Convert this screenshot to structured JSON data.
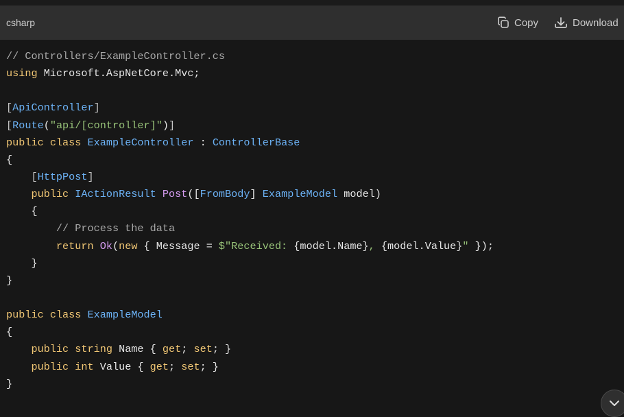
{
  "header": {
    "language": "csharp",
    "copy_label": "Copy",
    "download_label": "Download"
  },
  "code": {
    "lines": [
      [
        {
          "t": "cmt",
          "v": "// Controllers/ExampleController.cs"
        }
      ],
      [
        {
          "t": "kw",
          "v": "using"
        },
        {
          "t": "pl",
          "v": " Microsoft.AspNetCore.Mvc;"
        }
      ],
      [],
      [
        {
          "t": "br",
          "v": "["
        },
        {
          "t": "typ",
          "v": "ApiController"
        },
        {
          "t": "br",
          "v": "]"
        }
      ],
      [
        {
          "t": "br",
          "v": "["
        },
        {
          "t": "typ",
          "v": "Route"
        },
        {
          "t": "pl",
          "v": "("
        },
        {
          "t": "str",
          "v": "\"api/[controller]\""
        },
        {
          "t": "pl",
          "v": ")"
        },
        {
          "t": "br",
          "v": "]"
        }
      ],
      [
        {
          "t": "kw",
          "v": "public"
        },
        {
          "t": "pl",
          "v": " "
        },
        {
          "t": "kw",
          "v": "class"
        },
        {
          "t": "pl",
          "v": " "
        },
        {
          "t": "typ",
          "v": "ExampleController"
        },
        {
          "t": "pl",
          "v": " : "
        },
        {
          "t": "typ",
          "v": "ControllerBase"
        }
      ],
      [
        {
          "t": "pl",
          "v": "{"
        }
      ],
      [
        {
          "t": "pl",
          "v": "    "
        },
        {
          "t": "br",
          "v": "["
        },
        {
          "t": "typ",
          "v": "HttpPost"
        },
        {
          "t": "br",
          "v": "]"
        }
      ],
      [
        {
          "t": "pl",
          "v": "    "
        },
        {
          "t": "kw",
          "v": "public"
        },
        {
          "t": "pl",
          "v": " "
        },
        {
          "t": "typ",
          "v": "IActionResult"
        },
        {
          "t": "pl",
          "v": " "
        },
        {
          "t": "fn",
          "v": "Post"
        },
        {
          "t": "pl",
          "v": "(["
        },
        {
          "t": "typ",
          "v": "FromBody"
        },
        {
          "t": "pl",
          "v": "] "
        },
        {
          "t": "typ",
          "v": "ExampleModel"
        },
        {
          "t": "pl",
          "v": " model)"
        }
      ],
      [
        {
          "t": "pl",
          "v": "    {"
        }
      ],
      [
        {
          "t": "pl",
          "v": "        "
        },
        {
          "t": "cmt",
          "v": "// Process the data"
        }
      ],
      [
        {
          "t": "pl",
          "v": "        "
        },
        {
          "t": "kw",
          "v": "return"
        },
        {
          "t": "pl",
          "v": " "
        },
        {
          "t": "fn",
          "v": "Ok"
        },
        {
          "t": "pl",
          "v": "("
        },
        {
          "t": "kw",
          "v": "new"
        },
        {
          "t": "pl",
          "v": " { Message = "
        },
        {
          "t": "str",
          "v": "$\"Received: "
        },
        {
          "t": "pl",
          "v": "{model.Name}"
        },
        {
          "t": "str",
          "v": ", "
        },
        {
          "t": "pl",
          "v": "{model.Value}"
        },
        {
          "t": "str",
          "v": "\""
        },
        {
          "t": "pl",
          "v": " });"
        }
      ],
      [
        {
          "t": "pl",
          "v": "    }"
        }
      ],
      [
        {
          "t": "pl",
          "v": "}"
        }
      ],
      [],
      [
        {
          "t": "kw",
          "v": "public"
        },
        {
          "t": "pl",
          "v": " "
        },
        {
          "t": "kw",
          "v": "class"
        },
        {
          "t": "pl",
          "v": " "
        },
        {
          "t": "typ",
          "v": "ExampleModel"
        }
      ],
      [
        {
          "t": "pl",
          "v": "{"
        }
      ],
      [
        {
          "t": "pl",
          "v": "    "
        },
        {
          "t": "kw",
          "v": "public"
        },
        {
          "t": "pl",
          "v": " "
        },
        {
          "t": "kw",
          "v": "string"
        },
        {
          "t": "pl",
          "v": " Name { "
        },
        {
          "t": "kw",
          "v": "get"
        },
        {
          "t": "pl",
          "v": "; "
        },
        {
          "t": "kw",
          "v": "set"
        },
        {
          "t": "pl",
          "v": "; }"
        }
      ],
      [
        {
          "t": "pl",
          "v": "    "
        },
        {
          "t": "kw",
          "v": "public"
        },
        {
          "t": "pl",
          "v": " "
        },
        {
          "t": "kw",
          "v": "int"
        },
        {
          "t": "pl",
          "v": " Value { "
        },
        {
          "t": "kw",
          "v": "get"
        },
        {
          "t": "pl",
          "v": "; "
        },
        {
          "t": "kw",
          "v": "set"
        },
        {
          "t": "pl",
          "v": "; }"
        }
      ],
      [
        {
          "t": "pl",
          "v": "}"
        }
      ]
    ]
  },
  "icons": {
    "copy": "copy-icon",
    "download": "download-icon",
    "scroll": "chevron-down-icon"
  },
  "colors": {
    "background": "#171717",
    "header": "#2f2f2f",
    "comment": "#a9a9a9",
    "keyword": "#f0c674",
    "type": "#6cb2f5",
    "string": "#98c379",
    "function": "#d59cf0"
  }
}
